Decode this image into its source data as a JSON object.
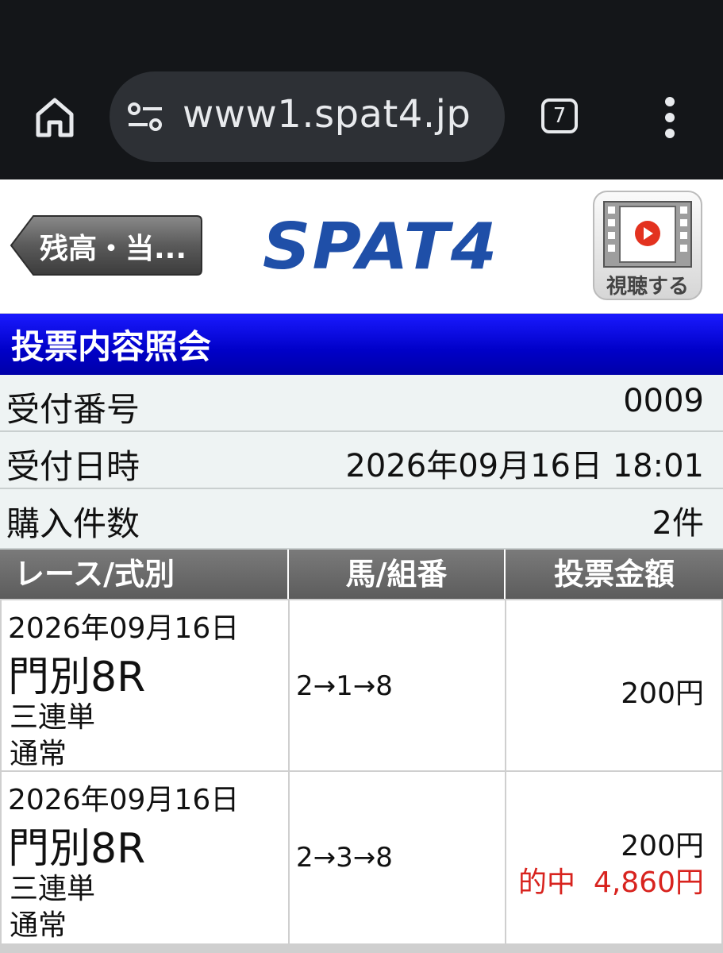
{
  "browser": {
    "url": "www1.spat4.jp",
    "tab_count": "7",
    "icons": [
      "home-icon",
      "site-settings-icon",
      "tabs-icon",
      "more-menu-icon"
    ]
  },
  "header": {
    "back_label": "残高・当...",
    "logo": "SPAT4",
    "watch_label": "視聴する"
  },
  "section_title": "投票内容照会",
  "info": [
    {
      "label": "受付番号",
      "value": "0009"
    },
    {
      "label": "受付日時",
      "value": "2026年09月16日 18:01"
    },
    {
      "label": "購入件数",
      "value": "2件"
    }
  ],
  "table": {
    "headers": [
      "レース/式別",
      "馬/組番",
      "投票金額"
    ],
    "rows": [
      {
        "date": "2026年09月16日",
        "race": "門別8R",
        "bet_type": "三連単",
        "kind": "通常",
        "combo": "2→1→8",
        "amount": "200円",
        "result": ""
      },
      {
        "date": "2026年09月16日",
        "race": "門別8R",
        "bet_type": "三連単",
        "kind": "通常",
        "combo": "2→3→8",
        "amount": "200円",
        "result": "的中  4,860円"
      }
    ]
  },
  "colors": {
    "title_bar": "#0000c8",
    "logo": "#1f4fa8",
    "hit_text": "#d8231e",
    "table_header": "#666666"
  }
}
